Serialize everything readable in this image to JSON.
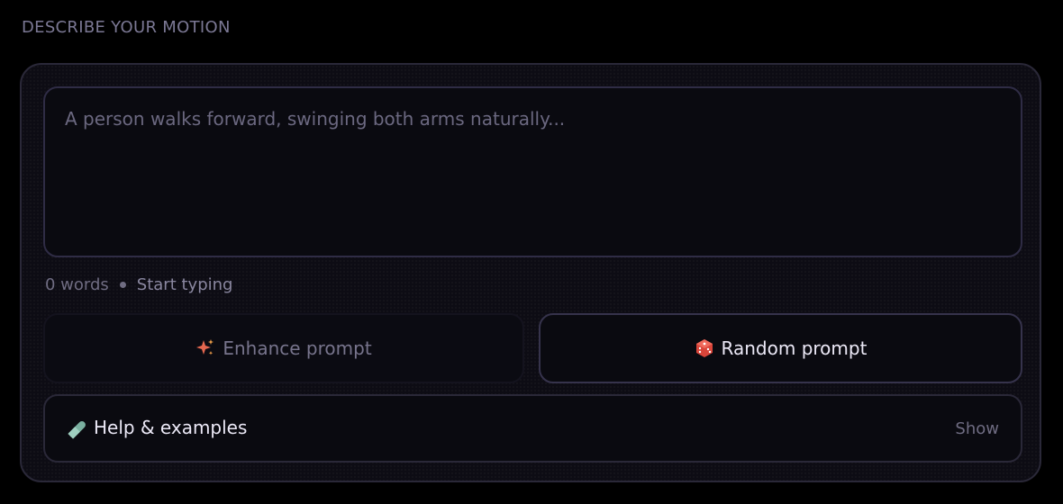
{
  "section": {
    "label": "DESCRIBE YOUR MOTION"
  },
  "prompt": {
    "value": "",
    "placeholder": "A person walks forward, swinging both arms naturally..."
  },
  "meta": {
    "word_count": "0 words",
    "status": "Start typing"
  },
  "actions": {
    "enhance": {
      "label": "Enhance prompt",
      "icon": "sparkles-icon"
    },
    "random": {
      "label": "Random prompt",
      "icon": "dice-icon"
    }
  },
  "help": {
    "title": "Help & examples",
    "toggle": "Show",
    "icon": "pill-icon"
  },
  "colors": {
    "background": "#000000",
    "card": "#0d0c14",
    "accent_sparkle": "#e5674f",
    "accent_dice": "#d9453a",
    "help_icon": "#7ab0a0"
  }
}
